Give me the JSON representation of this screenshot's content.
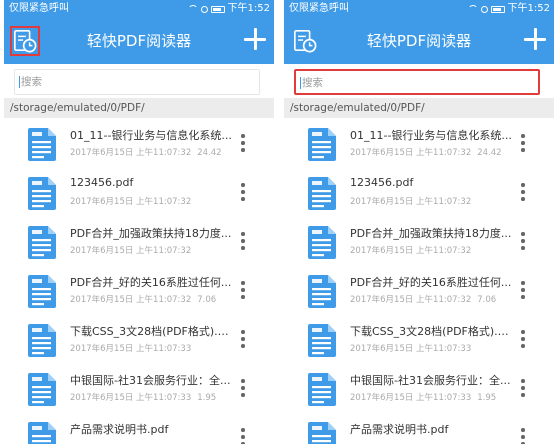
{
  "status": {
    "carrier": "仅限紧急呼叫",
    "time": "下午1:52"
  },
  "appbar": {
    "title": "轻快PDF阅读器"
  },
  "search": {
    "placeholder": "搜索"
  },
  "path": "/storage/emulated/0/PDF/",
  "icons": {
    "file": "pdf-file-icon",
    "menu": "history-icon",
    "add": "plus-icon",
    "more": "more-vert-icon"
  },
  "colors": {
    "primary": "#3f9be8",
    "highlight": "#e23b3b"
  },
  "files": [
    {
      "name": "01_11--银行业务与信息化系统...",
      "date": "2017年6月15日 上午11:07:32",
      "size": "24.42"
    },
    {
      "name": "123456.pdf",
      "date": "2017年6月15日 上午11:07:32",
      "size": ""
    },
    {
      "name": "PDF合并_加强政策扶持18力度...",
      "date": "2017年6月15日 上午11:07:32",
      "size": ""
    },
    {
      "name": "PDF合并_好的关16系胜过任何...",
      "date": "2017年6月15日 上午11:07:32",
      "size": "7.06"
    },
    {
      "name": "下载CSS_3文28档(PDF格式).p...",
      "date": "2017年6月15日 上午11:07:33",
      "size": ""
    },
    {
      "name": "中银国际-社31会服务行业：全...",
      "date": "2017年6月15日 上午11:07:33",
      "size": "1.95"
    },
    {
      "name": "产品需求说明书.pdf",
      "date": "",
      "size": ""
    }
  ]
}
